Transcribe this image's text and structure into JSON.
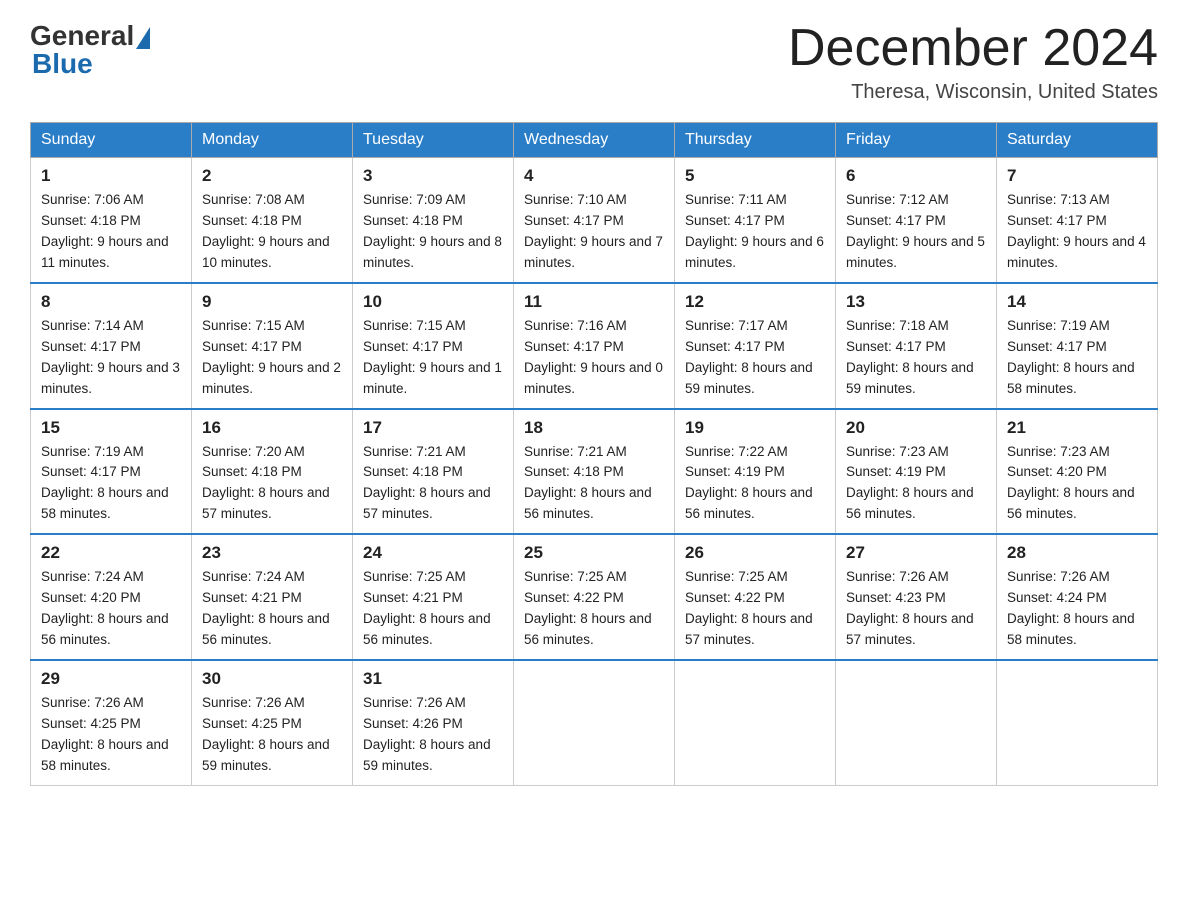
{
  "header": {
    "logo_general": "General",
    "logo_blue": "Blue",
    "month_title": "December 2024",
    "location": "Theresa, Wisconsin, United States"
  },
  "days_of_week": [
    "Sunday",
    "Monday",
    "Tuesday",
    "Wednesday",
    "Thursday",
    "Friday",
    "Saturday"
  ],
  "weeks": [
    [
      {
        "day": "1",
        "sunrise": "7:06 AM",
        "sunset": "4:18 PM",
        "daylight": "9 hours and 11 minutes."
      },
      {
        "day": "2",
        "sunrise": "7:08 AM",
        "sunset": "4:18 PM",
        "daylight": "9 hours and 10 minutes."
      },
      {
        "day": "3",
        "sunrise": "7:09 AM",
        "sunset": "4:18 PM",
        "daylight": "9 hours and 8 minutes."
      },
      {
        "day": "4",
        "sunrise": "7:10 AM",
        "sunset": "4:17 PM",
        "daylight": "9 hours and 7 minutes."
      },
      {
        "day": "5",
        "sunrise": "7:11 AM",
        "sunset": "4:17 PM",
        "daylight": "9 hours and 6 minutes."
      },
      {
        "day": "6",
        "sunrise": "7:12 AM",
        "sunset": "4:17 PM",
        "daylight": "9 hours and 5 minutes."
      },
      {
        "day": "7",
        "sunrise": "7:13 AM",
        "sunset": "4:17 PM",
        "daylight": "9 hours and 4 minutes."
      }
    ],
    [
      {
        "day": "8",
        "sunrise": "7:14 AM",
        "sunset": "4:17 PM",
        "daylight": "9 hours and 3 minutes."
      },
      {
        "day": "9",
        "sunrise": "7:15 AM",
        "sunset": "4:17 PM",
        "daylight": "9 hours and 2 minutes."
      },
      {
        "day": "10",
        "sunrise": "7:15 AM",
        "sunset": "4:17 PM",
        "daylight": "9 hours and 1 minute."
      },
      {
        "day": "11",
        "sunrise": "7:16 AM",
        "sunset": "4:17 PM",
        "daylight": "9 hours and 0 minutes."
      },
      {
        "day": "12",
        "sunrise": "7:17 AM",
        "sunset": "4:17 PM",
        "daylight": "8 hours and 59 minutes."
      },
      {
        "day": "13",
        "sunrise": "7:18 AM",
        "sunset": "4:17 PM",
        "daylight": "8 hours and 59 minutes."
      },
      {
        "day": "14",
        "sunrise": "7:19 AM",
        "sunset": "4:17 PM",
        "daylight": "8 hours and 58 minutes."
      }
    ],
    [
      {
        "day": "15",
        "sunrise": "7:19 AM",
        "sunset": "4:17 PM",
        "daylight": "8 hours and 58 minutes."
      },
      {
        "day": "16",
        "sunrise": "7:20 AM",
        "sunset": "4:18 PM",
        "daylight": "8 hours and 57 minutes."
      },
      {
        "day": "17",
        "sunrise": "7:21 AM",
        "sunset": "4:18 PM",
        "daylight": "8 hours and 57 minutes."
      },
      {
        "day": "18",
        "sunrise": "7:21 AM",
        "sunset": "4:18 PM",
        "daylight": "8 hours and 56 minutes."
      },
      {
        "day": "19",
        "sunrise": "7:22 AM",
        "sunset": "4:19 PM",
        "daylight": "8 hours and 56 minutes."
      },
      {
        "day": "20",
        "sunrise": "7:23 AM",
        "sunset": "4:19 PM",
        "daylight": "8 hours and 56 minutes."
      },
      {
        "day": "21",
        "sunrise": "7:23 AM",
        "sunset": "4:20 PM",
        "daylight": "8 hours and 56 minutes."
      }
    ],
    [
      {
        "day": "22",
        "sunrise": "7:24 AM",
        "sunset": "4:20 PM",
        "daylight": "8 hours and 56 minutes."
      },
      {
        "day": "23",
        "sunrise": "7:24 AM",
        "sunset": "4:21 PM",
        "daylight": "8 hours and 56 minutes."
      },
      {
        "day": "24",
        "sunrise": "7:25 AM",
        "sunset": "4:21 PM",
        "daylight": "8 hours and 56 minutes."
      },
      {
        "day": "25",
        "sunrise": "7:25 AM",
        "sunset": "4:22 PM",
        "daylight": "8 hours and 56 minutes."
      },
      {
        "day": "26",
        "sunrise": "7:25 AM",
        "sunset": "4:22 PM",
        "daylight": "8 hours and 57 minutes."
      },
      {
        "day": "27",
        "sunrise": "7:26 AM",
        "sunset": "4:23 PM",
        "daylight": "8 hours and 57 minutes."
      },
      {
        "day": "28",
        "sunrise": "7:26 AM",
        "sunset": "4:24 PM",
        "daylight": "8 hours and 58 minutes."
      }
    ],
    [
      {
        "day": "29",
        "sunrise": "7:26 AM",
        "sunset": "4:25 PM",
        "daylight": "8 hours and 58 minutes."
      },
      {
        "day": "30",
        "sunrise": "7:26 AM",
        "sunset": "4:25 PM",
        "daylight": "8 hours and 59 minutes."
      },
      {
        "day": "31",
        "sunrise": "7:26 AM",
        "sunset": "4:26 PM",
        "daylight": "8 hours and 59 minutes."
      },
      null,
      null,
      null,
      null
    ]
  ],
  "labels": {
    "sunrise": "Sunrise:",
    "sunset": "Sunset:",
    "daylight": "Daylight:"
  }
}
